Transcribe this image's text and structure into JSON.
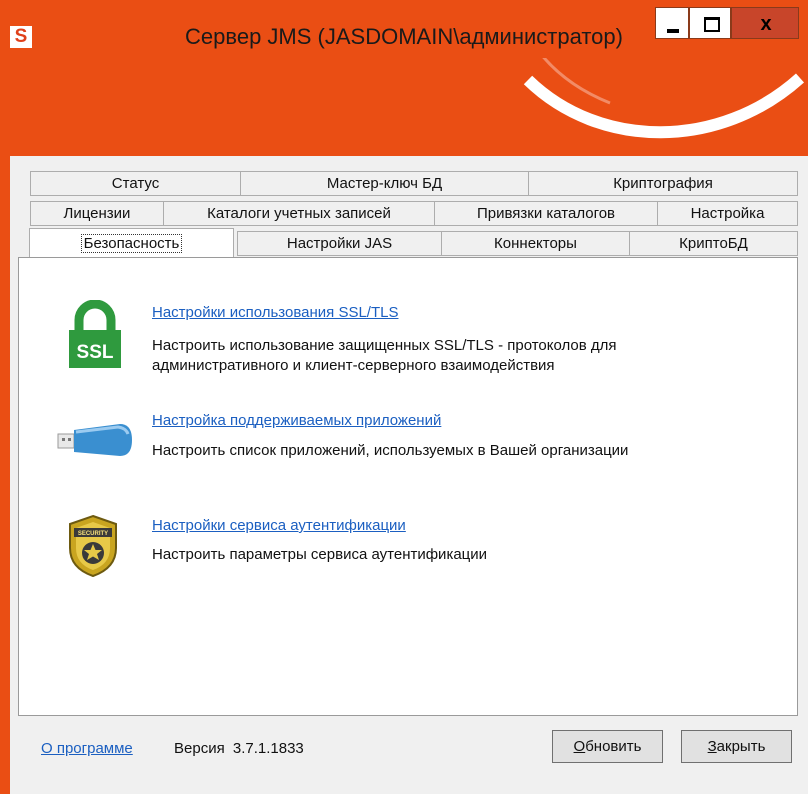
{
  "window": {
    "app_icon_letter": "S",
    "title": "Сервер JMS (JASDOMAIN\\администратор)",
    "close_glyph": "x"
  },
  "tabs": {
    "row1": [
      "Статус",
      "Мастер-ключ БД",
      "Криптография"
    ],
    "row2": [
      "Лицензии",
      "Каталоги учетных записей",
      "Привязки каталогов",
      "Настройка"
    ],
    "row3": [
      "Безопасность",
      "Настройки JAS",
      "Коннекторы",
      "КриптоБД"
    ],
    "active": "Безопасность"
  },
  "items": [
    {
      "icon": "ssl-lock-icon",
      "icon_text": "SSL",
      "title": "Настройки использования SSL/TLS",
      "desc_line1": "Настроить использование защищенных SSL/TLS - протоколов для",
      "desc_line2": "административного и клиент-серверного взаимодействия"
    },
    {
      "icon": "usb-key-icon",
      "title": "Настройка поддерживаемых приложений",
      "desc_line1": "Настроить список приложений, используемых в Вашей организации"
    },
    {
      "icon": "security-badge-icon",
      "icon_text": "SECURITY",
      "title": "Настройки сервиса аутентификации",
      "desc_line1": "Настроить параметры сервиса аутентификации"
    }
  ],
  "footer": {
    "about_link": "О программе",
    "version_label": "Версия",
    "version_value": "3.7.1.1833",
    "refresh_mnemonic": "О",
    "refresh_rest": "бновить",
    "close_mnemonic": "З",
    "close_rest": "акрыть"
  },
  "colors": {
    "accent": "#ea4e14",
    "link": "#1b5fc1",
    "ssl_green": "#2f9a3e"
  }
}
